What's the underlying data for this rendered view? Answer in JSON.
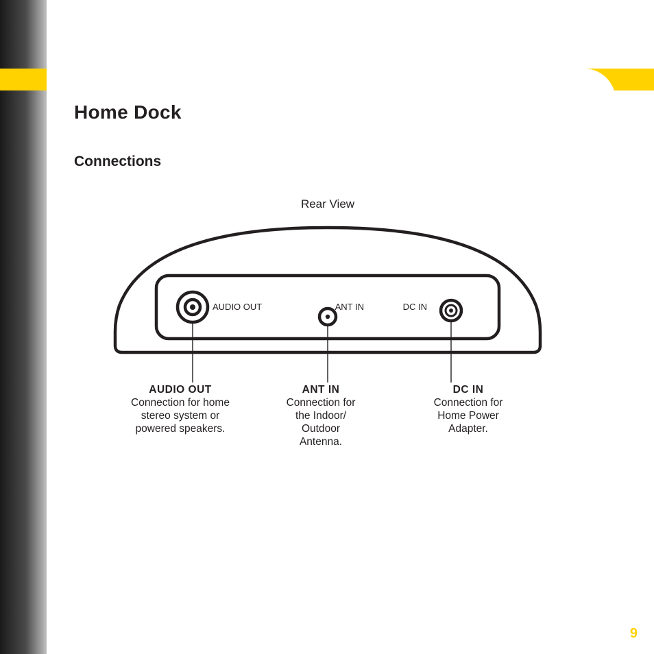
{
  "page": {
    "title": "Home Dock",
    "subtitle": "Connections",
    "number": "9"
  },
  "diagram": {
    "view_label": "Rear View",
    "port_labels": {
      "audio_out": "AUDIO OUT",
      "ant_in": "ANT IN",
      "dc_in": "DC IN"
    }
  },
  "callouts": {
    "audio_out": {
      "heading": "AUDIO OUT",
      "desc_l1": "Connection for home",
      "desc_l2": "stereo system or",
      "desc_l3": "powered speakers."
    },
    "ant_in": {
      "heading": "ANT IN",
      "desc_l1": "Connection for",
      "desc_l2": "the Indoor/",
      "desc_l3": "Outdoor",
      "desc_l4": "Antenna."
    },
    "dc_in": {
      "heading": "DC IN",
      "desc_l1": "Connection for",
      "desc_l2": "Home Power",
      "desc_l3": "Adapter."
    }
  }
}
